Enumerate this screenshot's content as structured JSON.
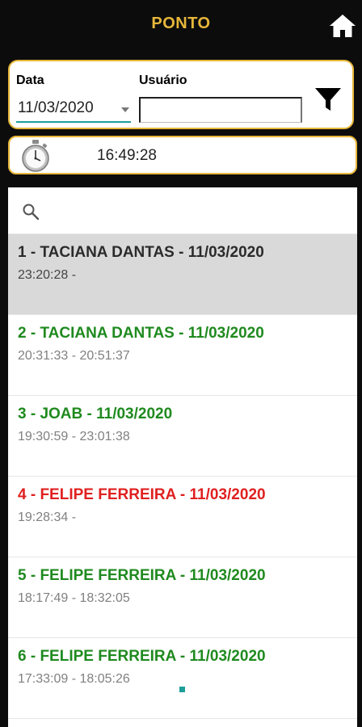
{
  "header": {
    "title": "PONTO",
    "home_icon": "home-icon"
  },
  "filter": {
    "date_label": "Data",
    "user_label": "Usuário",
    "date_value": "11/03/2020",
    "user_value": "",
    "filter_icon": "filter-icon",
    "accent_color": "#e7b73a",
    "underline_color": "#1e9e9a"
  },
  "clock": {
    "icon": "stopwatch-icon",
    "time": "16:49:28"
  },
  "search": {
    "icon": "search-icon",
    "placeholder": ""
  },
  "entries": [
    {
      "title": "1 - TACIANA DANTAS - 11/03/2020",
      "times": "23:20:28 -",
      "status": "selected",
      "color": "#2b2b2b"
    },
    {
      "title": "2 - TACIANA DANTAS - 11/03/2020",
      "times": "20:31:33 - 20:51:37",
      "status": "complete",
      "color": "#1f8a1f"
    },
    {
      "title": "3 - JOAB - 11/03/2020",
      "times": "19:30:59 - 23:01:38",
      "status": "complete",
      "color": "#1f8a1f"
    },
    {
      "title": "4 - FELIPE FERREIRA - 11/03/2020",
      "times": "19:28:34 -",
      "status": "open",
      "color": "#e02020"
    },
    {
      "title": "5 - FELIPE FERREIRA - 11/03/2020",
      "times": "18:17:49 - 18:32:05",
      "status": "complete",
      "color": "#1f8a1f"
    },
    {
      "title": "6 - FELIPE FERREIRA - 11/03/2020",
      "times": "17:33:09 - 18:05:26",
      "status": "complete",
      "color": "#1f8a1f"
    }
  ]
}
